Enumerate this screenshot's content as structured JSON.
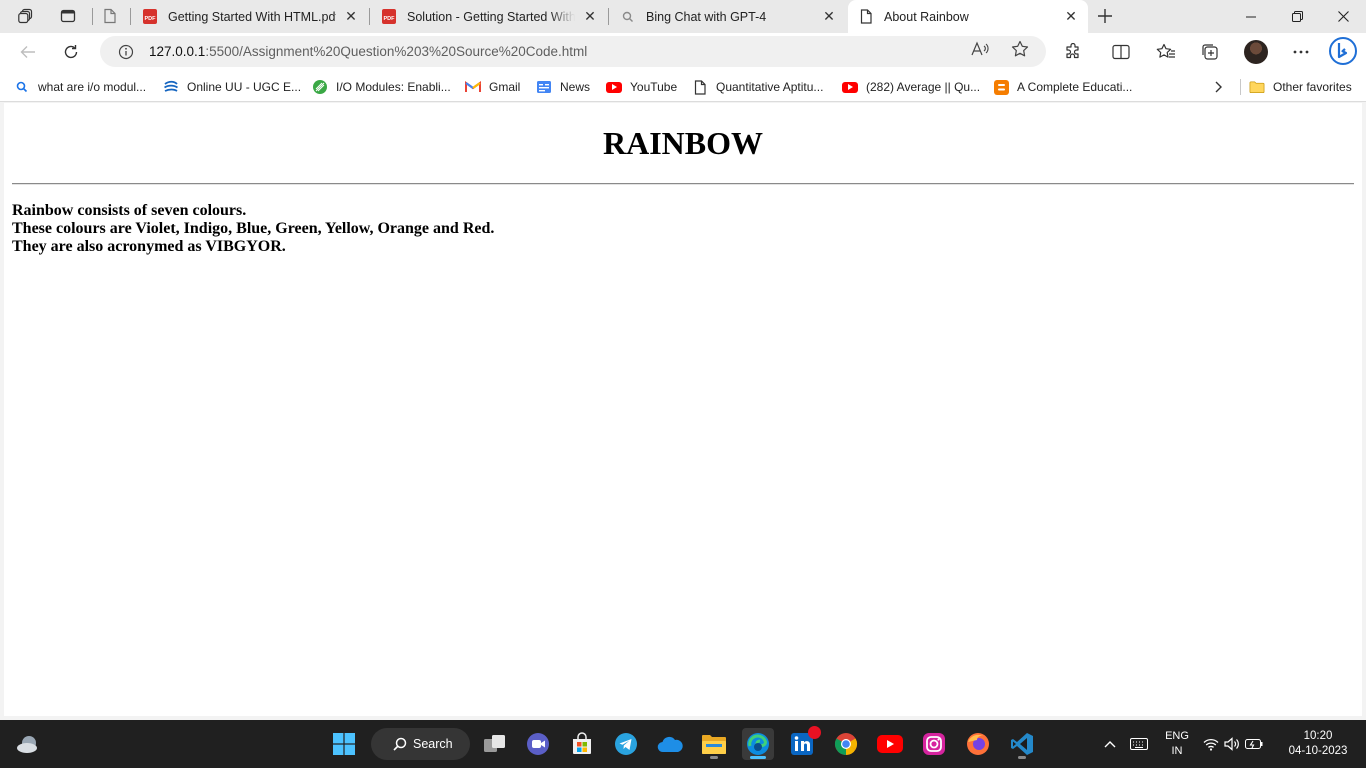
{
  "browser": {
    "tabs": [
      {
        "title": "Getting Started With HTML.pdf",
        "icon": "pdf-icon"
      },
      {
        "title": "Solution - Getting Started With H",
        "icon": "pdf-icon"
      },
      {
        "title": "Bing Chat with GPT-4",
        "icon": "search-icon"
      },
      {
        "title": "About Rainbow",
        "icon": "page-icon",
        "active": true
      }
    ],
    "pdf_badge": "PDF",
    "address": {
      "host": "127.0.0.1",
      "path": ":5500/Assignment%20Question%203%20Source%20Code.html"
    },
    "favorites": [
      {
        "label": "what are i/o modul...",
        "icon": "search-icon"
      },
      {
        "label": "Online UU - UGC E...",
        "icon": "globe-icon"
      },
      {
        "label": "I/O Modules: Enabli...",
        "icon": "leaf-icon"
      },
      {
        "label": "Gmail",
        "icon": "gmail-icon"
      },
      {
        "label": "News",
        "icon": "news-icon"
      },
      {
        "label": "YouTube",
        "icon": "youtube-icon"
      },
      {
        "label": "Quantitative Aptitu...",
        "icon": "page-icon"
      },
      {
        "label": "(282) Average || Qu...",
        "icon": "youtube-icon"
      },
      {
        "label": "A Complete Educati...",
        "icon": "blogger-icon"
      }
    ],
    "other_favorites": "Other favorites"
  },
  "page": {
    "heading": "RAINBOW",
    "lines": [
      "Rainbow consists of seven colours.",
      "These colours are Violet, Indigo, Blue, Green, Yellow, Orange and Red.",
      "They are also acronymed as VIBGYOR."
    ]
  },
  "taskbar": {
    "search_label": "Search",
    "lang_line1": "ENG",
    "lang_line2": "IN",
    "time": "10:20",
    "date": "04-10-2023"
  },
  "colors": {
    "accent": "#0078d4",
    "taskbar_bg": "#202020",
    "active_indicator": "#4cc2ff"
  }
}
